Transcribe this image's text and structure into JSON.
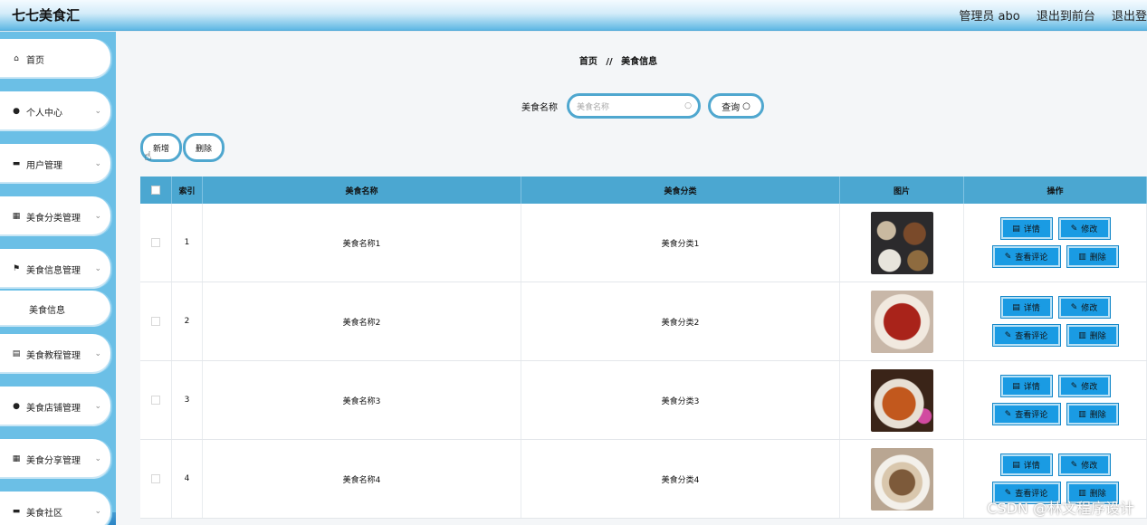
{
  "app": {
    "title": "七七美食汇"
  },
  "header": {
    "user": "管理员 abo",
    "to_front": "退出到前台",
    "logout": "退出登"
  },
  "sidebar": {
    "items": [
      {
        "label": "首页",
        "icon": "home-icon",
        "glyph": "⌂",
        "chevron": false
      },
      {
        "label": "个人中心",
        "icon": "user-icon",
        "glyph": "●",
        "chevron": true
      },
      {
        "label": "用户管理",
        "icon": "briefcase-icon",
        "glyph": "▬",
        "chevron": true
      },
      {
        "label": "美食分类管理",
        "icon": "grid-icon",
        "glyph": "▦",
        "chevron": true
      },
      {
        "label": "美食信息管理",
        "icon": "flag-icon",
        "glyph": "⚑",
        "chevron": true
      },
      {
        "label": "美食信息",
        "icon": "",
        "glyph": "",
        "chevron": false,
        "sub": true
      },
      {
        "label": "美食教程管理",
        "icon": "clipboard-icon",
        "glyph": "▤",
        "chevron": true
      },
      {
        "label": "美食店铺管理",
        "icon": "person-icon",
        "glyph": "●",
        "chevron": true
      },
      {
        "label": "美食分享管理",
        "icon": "grid-icon",
        "glyph": "▦",
        "chevron": true
      },
      {
        "label": "美食社区",
        "icon": "ticket-icon",
        "glyph": "▬",
        "chevron": true
      }
    ]
  },
  "breadcrumb": {
    "home": "首页",
    "sep": "//",
    "current": "美食信息"
  },
  "search": {
    "label": "美食名称",
    "placeholder": "美食名称",
    "button": "查询"
  },
  "actions": {
    "add": "新增",
    "delete": "删除"
  },
  "table": {
    "headers": {
      "index": "索引",
      "name": "美食名称",
      "category": "美食分类",
      "image": "图片",
      "ops": "操作"
    },
    "rows": [
      {
        "index": "1",
        "name": "美食名称1",
        "category": "美食分类1",
        "image": "food-photo-1"
      },
      {
        "index": "2",
        "name": "美食名称2",
        "category": "美食分类2",
        "image": "food-photo-2"
      },
      {
        "index": "3",
        "name": "美食名称3",
        "category": "美食分类3",
        "image": "food-photo-3"
      },
      {
        "index": "4",
        "name": "美食名称4",
        "category": "美食分类4",
        "image": "food-photo-4"
      }
    ],
    "op_labels": {
      "detail": "详情",
      "edit": "修改",
      "comments": "查看评论",
      "delete": "删除"
    }
  },
  "watermark": "CSDN @林文程序设计",
  "colors": {
    "accent": "#4ba7d1",
    "button": "#1a9be3",
    "sidebar": "#6bbfe6"
  }
}
